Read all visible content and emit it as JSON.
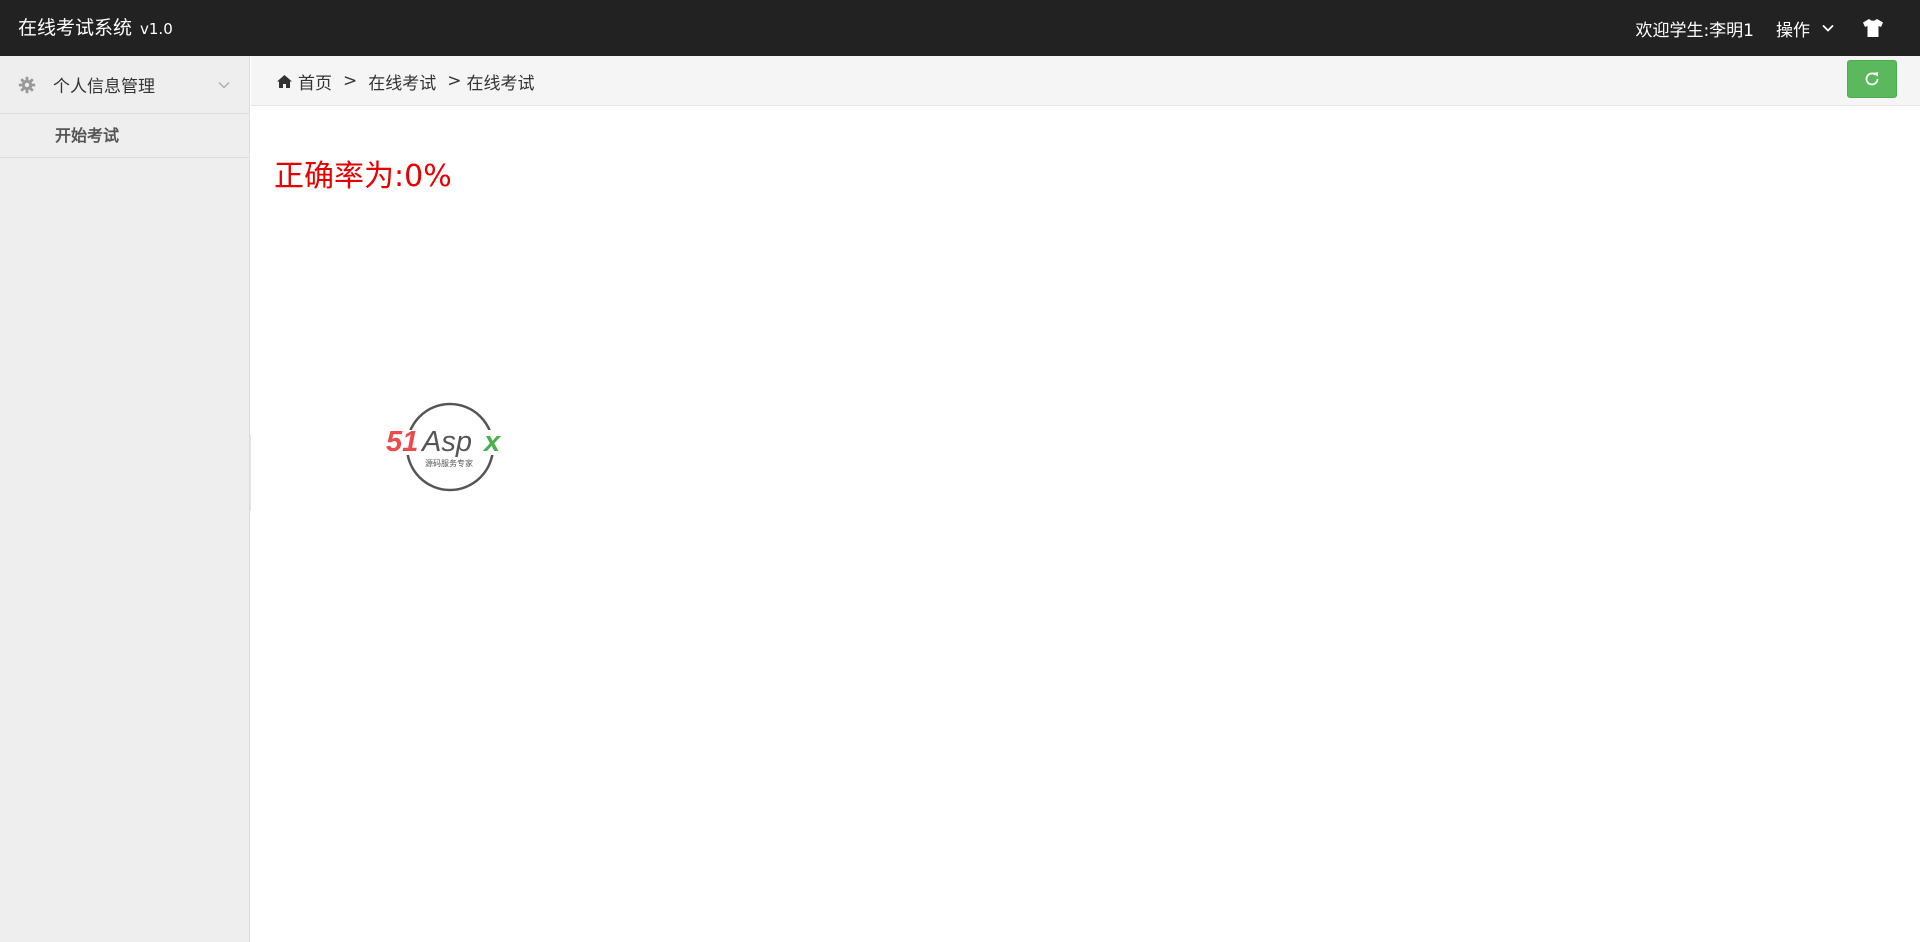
{
  "header": {
    "app_title": "在线考试系统",
    "version": "v1.0",
    "welcome_text": "欢迎学生:李明1",
    "operations_label": "操作",
    "background_color": "#222222"
  },
  "sidebar": {
    "groups": [
      {
        "label": "个人信息管理",
        "icon": "gear-icon",
        "expanded": true,
        "items": [
          {
            "label": "开始考试"
          }
        ]
      }
    ]
  },
  "breadcrumb": {
    "home_icon": "home-icon",
    "items": [
      "首页",
      "在线考试",
      "在线考试"
    ],
    "separator": ">"
  },
  "toolbar": {
    "refresh_icon": "refresh-icon",
    "refresh_color": "#5cb85c"
  },
  "main": {
    "result_text": "正确率为:0%",
    "result_color": "#e60000",
    "logo": {
      "brand_text": "51Aspx",
      "tagline": "源码服务专家",
      "brand_red": "#e84c4c",
      "brand_green": "#4caf50"
    }
  }
}
